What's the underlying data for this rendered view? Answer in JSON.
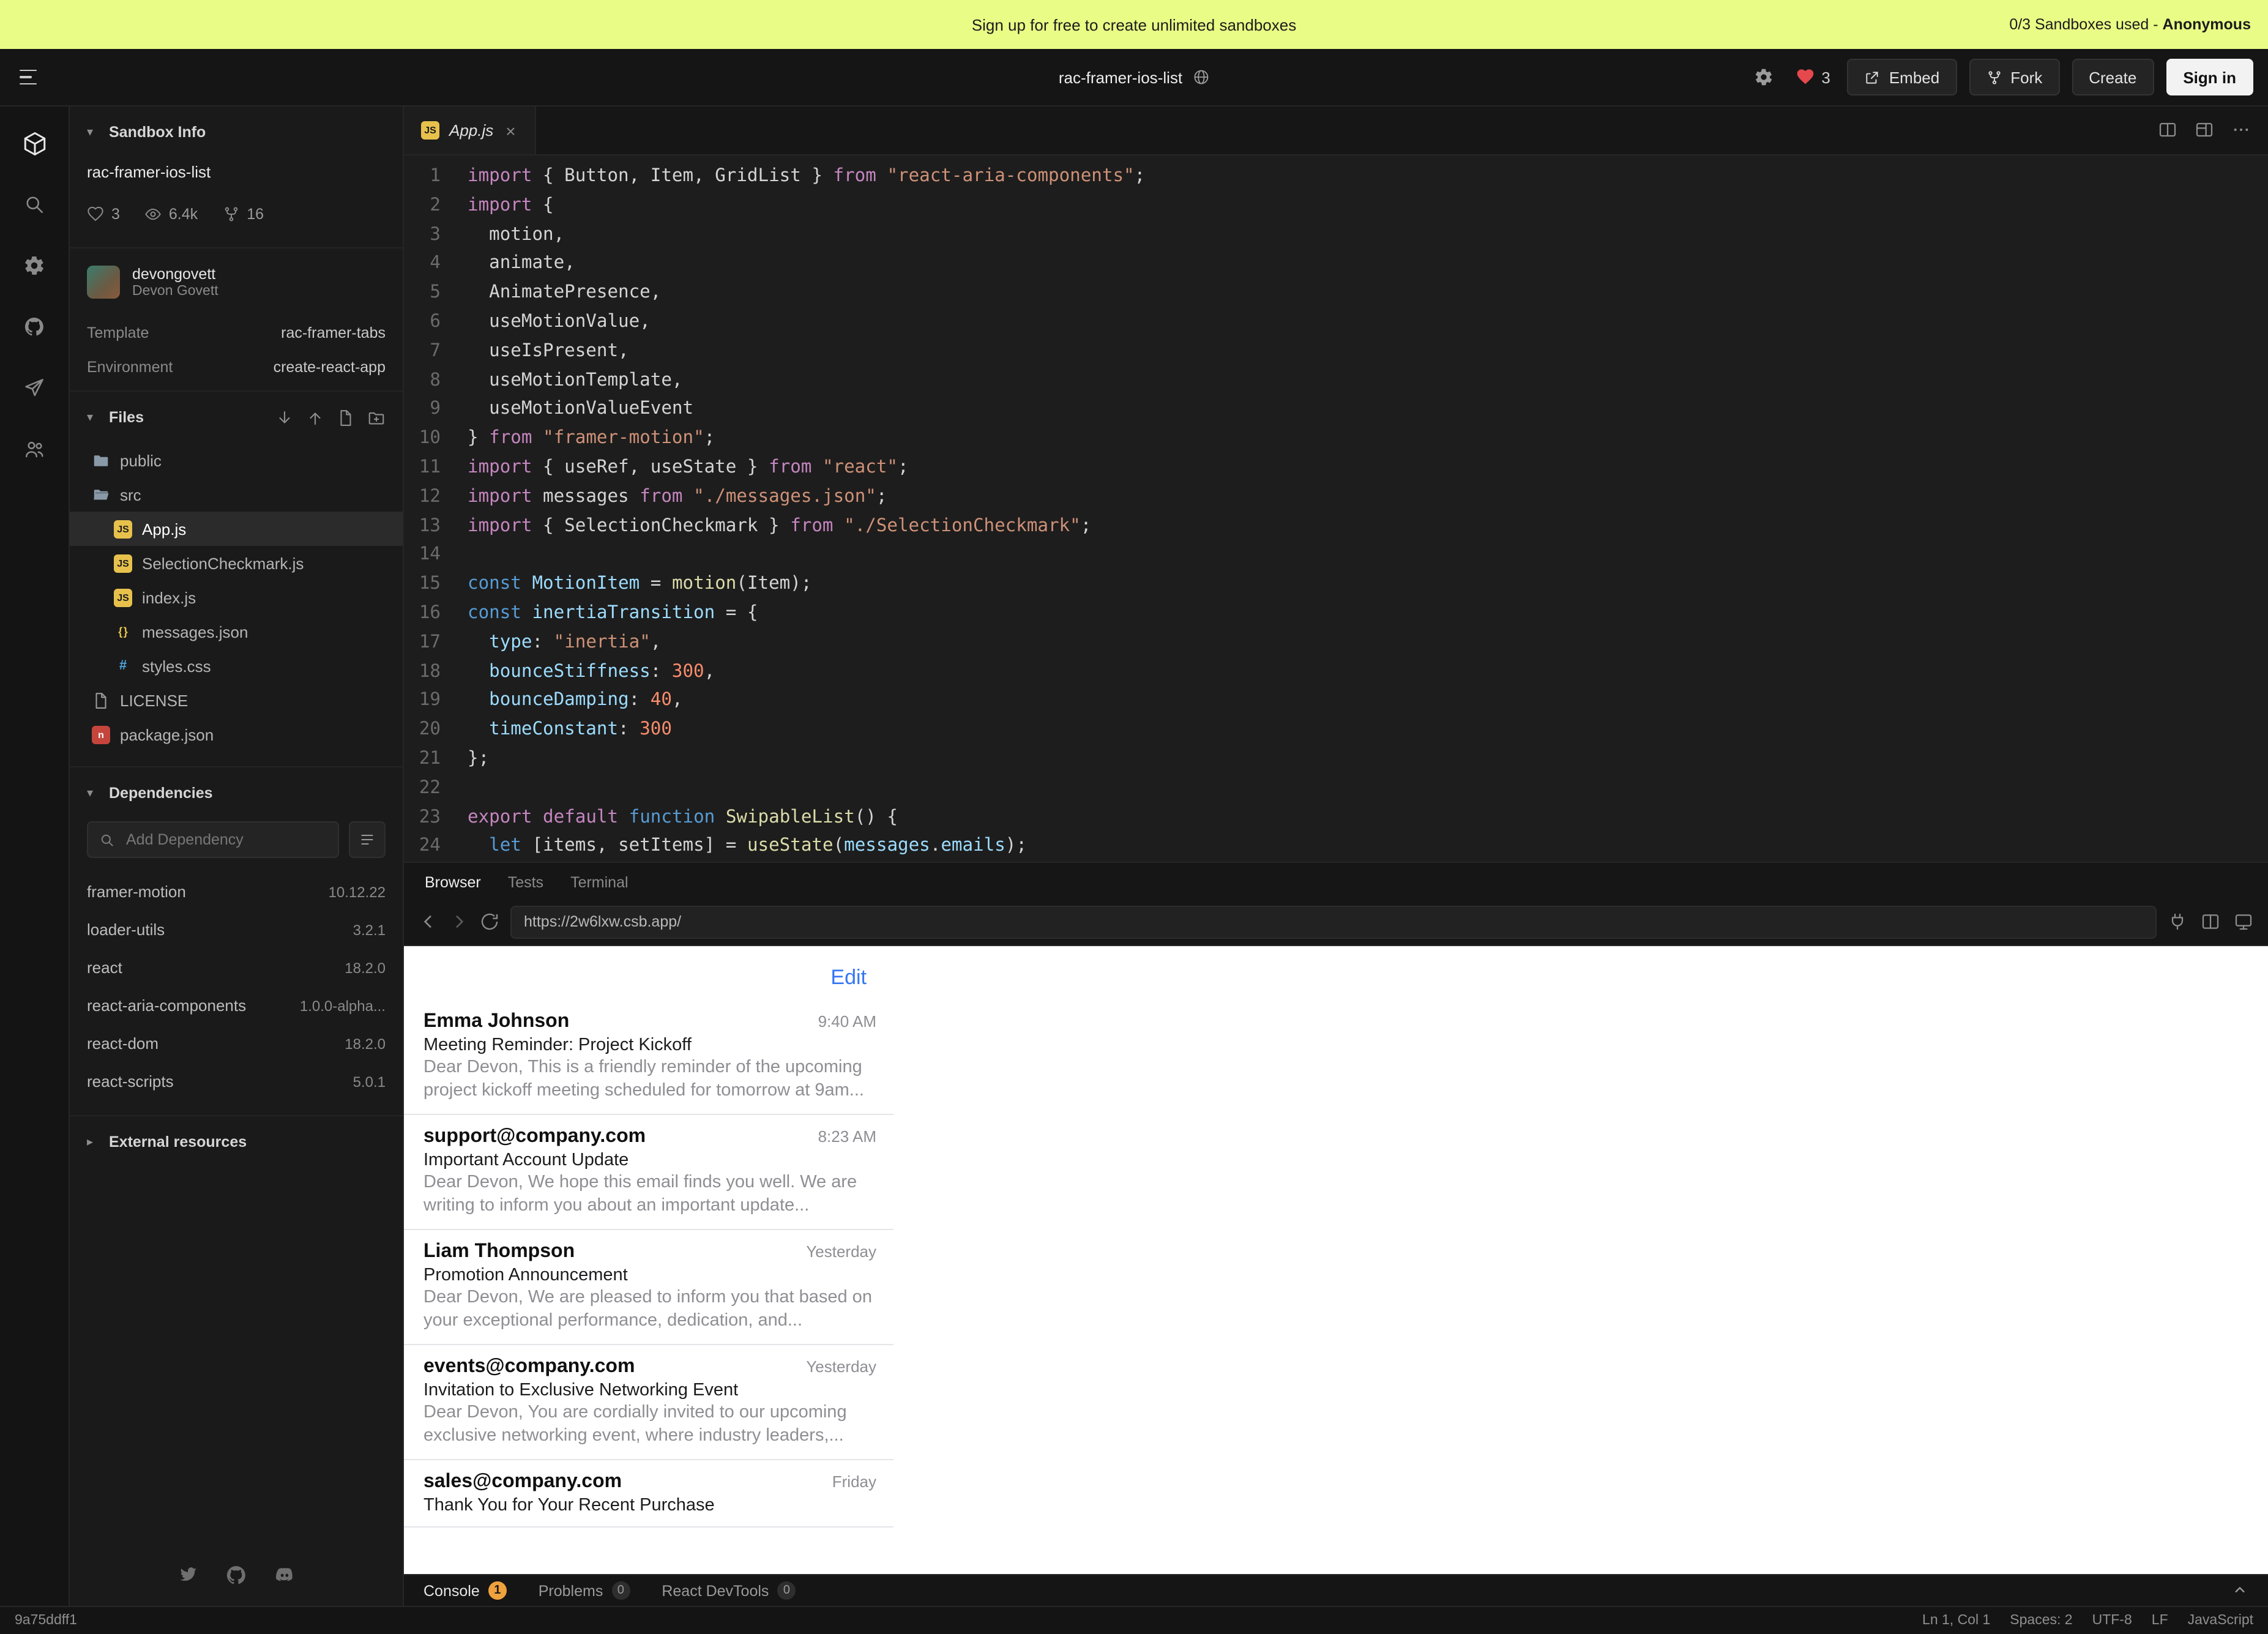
{
  "banner": {
    "text": "Sign up for free to create unlimited sandboxes",
    "usage": "0/3 Sandboxes used -",
    "user": "Anonymous"
  },
  "header": {
    "title": "rac-framer-ios-list",
    "likes": "3",
    "embed": "Embed",
    "fork": "Fork",
    "create": "Create",
    "sign_in": "Sign in"
  },
  "rail": {
    "icons": [
      "sandbox-logo",
      "search",
      "settings",
      "github",
      "deploy",
      "team"
    ]
  },
  "sidebar": {
    "sandbox_info": {
      "section": "Sandbox Info",
      "title": "rac-framer-ios-list",
      "likes": "3",
      "views": "6.4k",
      "forks": "16",
      "author_username": "devongovett",
      "author_name": "Devon Govett",
      "template_label": "Template",
      "template_value": "rac-framer-tabs",
      "environment_label": "Environment",
      "environment_value": "create-react-app"
    },
    "files": {
      "section": "Files",
      "actions": [
        "download",
        "upload",
        "new-file",
        "new-folder"
      ],
      "items": [
        {
          "name": "public",
          "type": "folder",
          "depth": 0,
          "selected": false
        },
        {
          "name": "src",
          "type": "folder-open",
          "depth": 0,
          "selected": false
        },
        {
          "name": "App.js",
          "type": "js",
          "depth": 1,
          "selected": true
        },
        {
          "name": "SelectionCheckmark.js",
          "type": "js",
          "depth": 1,
          "selected": false
        },
        {
          "name": "index.js",
          "type": "js",
          "depth": 1,
          "selected": false
        },
        {
          "name": "messages.json",
          "type": "json",
          "depth": 1,
          "selected": false
        },
        {
          "name": "styles.css",
          "type": "css",
          "depth": 1,
          "selected": false
        },
        {
          "name": "LICENSE",
          "type": "file",
          "depth": 0,
          "selected": false
        },
        {
          "name": "package.json",
          "type": "npm",
          "depth": 0,
          "selected": false
        }
      ]
    },
    "dependencies": {
      "section": "Dependencies",
      "search_placeholder": "Add Dependency",
      "items": [
        {
          "name": "framer-motion",
          "version": "10.12.22"
        },
        {
          "name": "loader-utils",
          "version": "3.2.1"
        },
        {
          "name": "react",
          "version": "18.2.0"
        },
        {
          "name": "react-aria-components",
          "version": "1.0.0-alpha..."
        },
        {
          "name": "react-dom",
          "version": "18.2.0"
        },
        {
          "name": "react-scripts",
          "version": "5.0.1"
        }
      ]
    },
    "external": {
      "section": "External resources"
    },
    "social": [
      "twitter",
      "github",
      "discord"
    ]
  },
  "editor": {
    "tab": "App.js",
    "tab_actions": [
      "split-editor",
      "layout",
      "more"
    ],
    "code_lines": [
      [
        [
          "k",
          "import"
        ],
        [
          "p",
          " { "
        ],
        [
          "w",
          "Button"
        ],
        [
          "p",
          ", "
        ],
        [
          "w",
          "Item"
        ],
        [
          "p",
          ", "
        ],
        [
          "w",
          "GridList"
        ],
        [
          "p",
          " } "
        ],
        [
          "k",
          "from"
        ],
        [
          "p",
          " "
        ],
        [
          "s",
          "\"react-aria-components\""
        ],
        [
          "p",
          ";"
        ]
      ],
      [
        [
          "k",
          "import"
        ],
        [
          "p",
          " {"
        ]
      ],
      [
        [
          "p",
          "  "
        ],
        [
          "w",
          "motion"
        ],
        [
          "p",
          ","
        ]
      ],
      [
        [
          "p",
          "  "
        ],
        [
          "w",
          "animate"
        ],
        [
          "p",
          ","
        ]
      ],
      [
        [
          "p",
          "  "
        ],
        [
          "w",
          "AnimatePresence"
        ],
        [
          "p",
          ","
        ]
      ],
      [
        [
          "p",
          "  "
        ],
        [
          "w",
          "useMotionValue"
        ],
        [
          "p",
          ","
        ]
      ],
      [
        [
          "p",
          "  "
        ],
        [
          "w",
          "useIsPresent"
        ],
        [
          "p",
          ","
        ]
      ],
      [
        [
          "p",
          "  "
        ],
        [
          "w",
          "useMotionTemplate"
        ],
        [
          "p",
          ","
        ]
      ],
      [
        [
          "p",
          "  "
        ],
        [
          "w",
          "useMotionValueEvent"
        ]
      ],
      [
        [
          "p",
          "} "
        ],
        [
          "k",
          "from"
        ],
        [
          "p",
          " "
        ],
        [
          "s",
          "\"framer-motion\""
        ],
        [
          "p",
          ";"
        ]
      ],
      [
        [
          "k",
          "import"
        ],
        [
          "p",
          " { "
        ],
        [
          "w",
          "useRef"
        ],
        [
          "p",
          ", "
        ],
        [
          "w",
          "useState"
        ],
        [
          "p",
          " } "
        ],
        [
          "k",
          "from"
        ],
        [
          "p",
          " "
        ],
        [
          "s",
          "\"react\""
        ],
        [
          "p",
          ";"
        ]
      ],
      [
        [
          "k",
          "import"
        ],
        [
          "p",
          " "
        ],
        [
          "w",
          "messages"
        ],
        [
          "p",
          " "
        ],
        [
          "k",
          "from"
        ],
        [
          "p",
          " "
        ],
        [
          "s",
          "\"./messages.json\""
        ],
        [
          "p",
          ";"
        ]
      ],
      [
        [
          "k",
          "import"
        ],
        [
          "p",
          " { "
        ],
        [
          "w",
          "SelectionCheckmark"
        ],
        [
          "p",
          " } "
        ],
        [
          "k",
          "from"
        ],
        [
          "p",
          " "
        ],
        [
          "s",
          "\"./SelectionCheckmark\""
        ],
        [
          "p",
          ";"
        ]
      ],
      [],
      [
        [
          "d",
          "const"
        ],
        [
          "p",
          " "
        ],
        [
          "v",
          "MotionItem"
        ],
        [
          "p",
          " = "
        ],
        [
          "f",
          "motion"
        ],
        [
          "p",
          "("
        ],
        [
          "w",
          "Item"
        ],
        [
          "p",
          ");"
        ]
      ],
      [
        [
          "d",
          "const"
        ],
        [
          "p",
          " "
        ],
        [
          "v",
          "inertiaTransition"
        ],
        [
          "p",
          " = {"
        ]
      ],
      [
        [
          "p",
          "  "
        ],
        [
          "v",
          "type"
        ],
        [
          "p",
          ": "
        ],
        [
          "s",
          "\"inertia\""
        ],
        [
          "p",
          ","
        ]
      ],
      [
        [
          "p",
          "  "
        ],
        [
          "v",
          "bounceStiffness"
        ],
        [
          "p",
          ": "
        ],
        [
          "n",
          "300"
        ],
        [
          "p",
          ","
        ]
      ],
      [
        [
          "p",
          "  "
        ],
        [
          "v",
          "bounceDamping"
        ],
        [
          "p",
          ": "
        ],
        [
          "n",
          "40"
        ],
        [
          "p",
          ","
        ]
      ],
      [
        [
          "p",
          "  "
        ],
        [
          "v",
          "timeConstant"
        ],
        [
          "p",
          ": "
        ],
        [
          "n",
          "300"
        ]
      ],
      [
        [
          "p",
          "};"
        ]
      ],
      [],
      [
        [
          "k",
          "export"
        ],
        [
          "p",
          " "
        ],
        [
          "k",
          "default"
        ],
        [
          "p",
          " "
        ],
        [
          "d",
          "function"
        ],
        [
          "p",
          " "
        ],
        [
          "f",
          "SwipableList"
        ],
        [
          "p",
          "() {"
        ]
      ],
      [
        [
          "p",
          "  "
        ],
        [
          "d",
          "let"
        ],
        [
          "p",
          " ["
        ],
        [
          "w",
          "items"
        ],
        [
          "p",
          ", "
        ],
        [
          "w",
          "setItems"
        ],
        [
          "p",
          "] = "
        ],
        [
          "f",
          "useState"
        ],
        [
          "p",
          "("
        ],
        [
          "v",
          "messages"
        ],
        [
          "p",
          "."
        ],
        [
          "v",
          "emails"
        ],
        [
          "p",
          ");"
        ]
      ]
    ]
  },
  "preview": {
    "tabs": [
      "Browser",
      "Tests",
      "Terminal"
    ],
    "url": "https://2w6lxw.csb.app/",
    "url_icons": [
      "connect",
      "split-view",
      "responsive-mode"
    ],
    "edit_button": "Edit",
    "emails": [
      {
        "sender": "Emma Johnson",
        "time": "9:40 AM",
        "subject": "Meeting Reminder: Project Kickoff",
        "preview": "Dear Devon, This is a friendly reminder of the upcoming project kickoff meeting scheduled for tomorrow at 9am..."
      },
      {
        "sender": "support@company.com",
        "time": "8:23 AM",
        "subject": "Important Account Update",
        "preview": "Dear Devon, We hope this email finds you well. We are writing to inform you about an important update..."
      },
      {
        "sender": "Liam Thompson",
        "time": "Yesterday",
        "subject": "Promotion Announcement",
        "preview": "Dear Devon, We are pleased to inform you that based on your exceptional performance, dedication, and..."
      },
      {
        "sender": "events@company.com",
        "time": "Yesterday",
        "subject": "Invitation to Exclusive Networking Event",
        "preview": "Dear Devon, You are cordially invited to our upcoming exclusive networking event, where industry leaders,..."
      },
      {
        "sender": "sales@company.com",
        "time": "Friday",
        "subject": "Thank You for Your Recent Purchase",
        "preview": ""
      }
    ]
  },
  "console_bar": {
    "console_label": "Console",
    "console_badge": "1",
    "problems_label": "Problems",
    "problems_count": "0",
    "devtools_label": "React DevTools",
    "devtools_count": "0"
  },
  "status_bar": {
    "hash": "9a75ddff1",
    "cursor": "Ln 1, Col 1",
    "spaces": "Spaces: 2",
    "encoding": "UTF-8",
    "eol": "LF",
    "language": "JavaScript"
  }
}
